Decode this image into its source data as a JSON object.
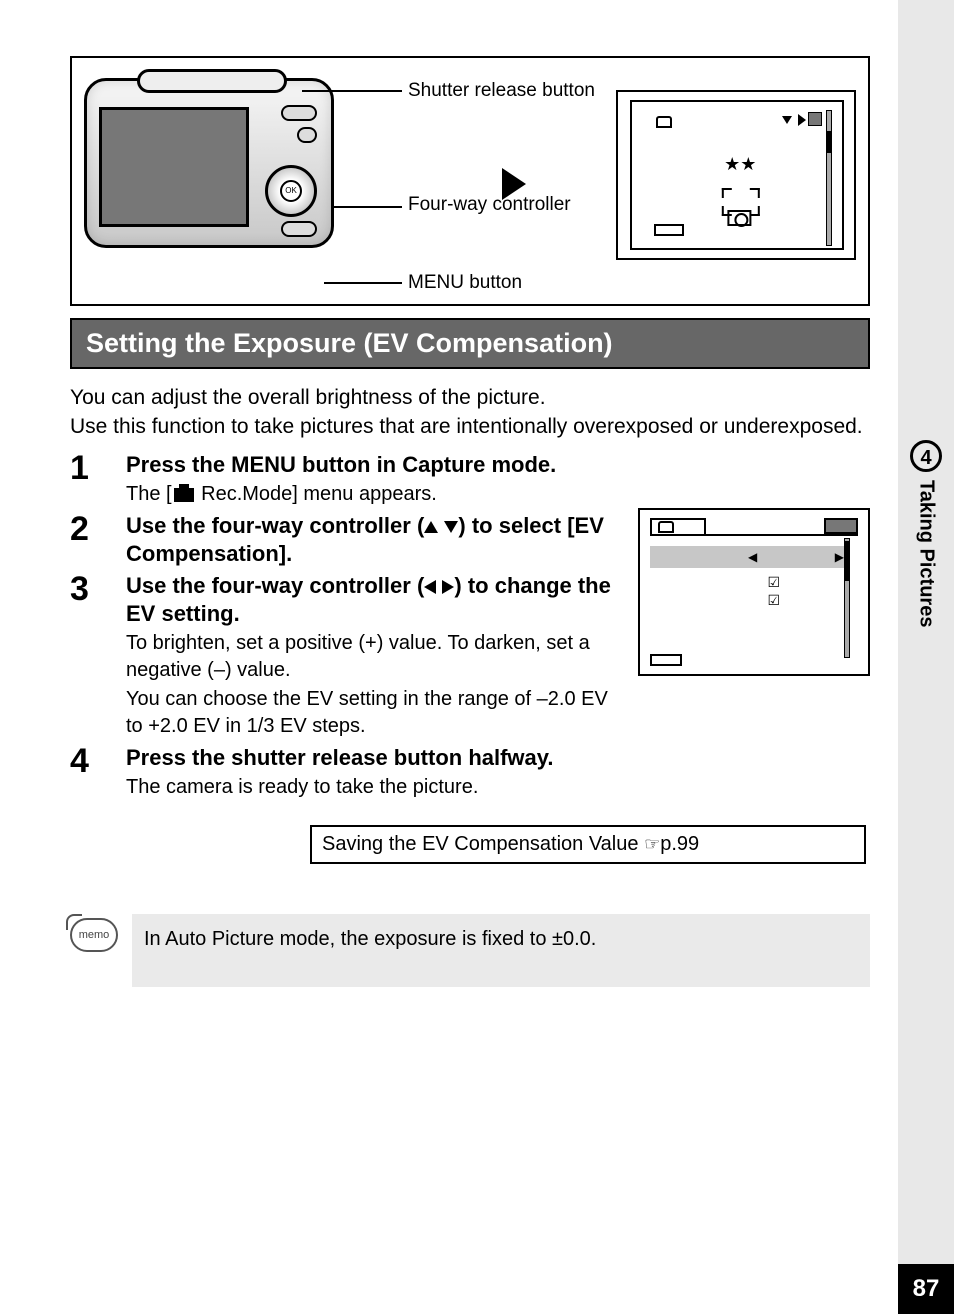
{
  "diagram": {
    "label_shutter": "Shutter release button",
    "label_fourway": "Four-way controller",
    "label_menu": "MENU button"
  },
  "heading": "Setting the Exposure (EV Compensation)",
  "intro_line1": "You can adjust the overall brightness of the picture.",
  "intro_line2": "Use this function to take pictures that are intentionally overexposed or underexposed.",
  "steps": {
    "s1_title": "Press the MENU button in Capture mode.",
    "s1_desc_pre": "The [",
    "s1_desc_post": " Rec.Mode] menu appears.",
    "s2_title_a": "Use the four-way controller (",
    "s2_title_b": ") to select [EV Compensation].",
    "s3_title_a": "Use the four-way controller (",
    "s3_title_b": ") to change the EV setting.",
    "s3_desc_a": "To brighten, set a positive (+) value. To darken, set a negative (–) value.",
    "s3_desc_b": "You can choose the EV setting in the range of –2.0 EV to +2.0 EV in 1/3 EV steps.",
    "s4_title": "Press the shutter release button halfway.",
    "s4_desc": "The camera is ready to take the picture."
  },
  "reference": {
    "text": "Saving the EV Compensation Value ",
    "page": "p.99"
  },
  "memo": {
    "label": "memo",
    "text": "In Auto Picture mode, the exposure is fixed to ±0.0."
  },
  "side": {
    "chapter_num": "4",
    "chapter_label": "Taking Pictures"
  },
  "page_number": "87"
}
